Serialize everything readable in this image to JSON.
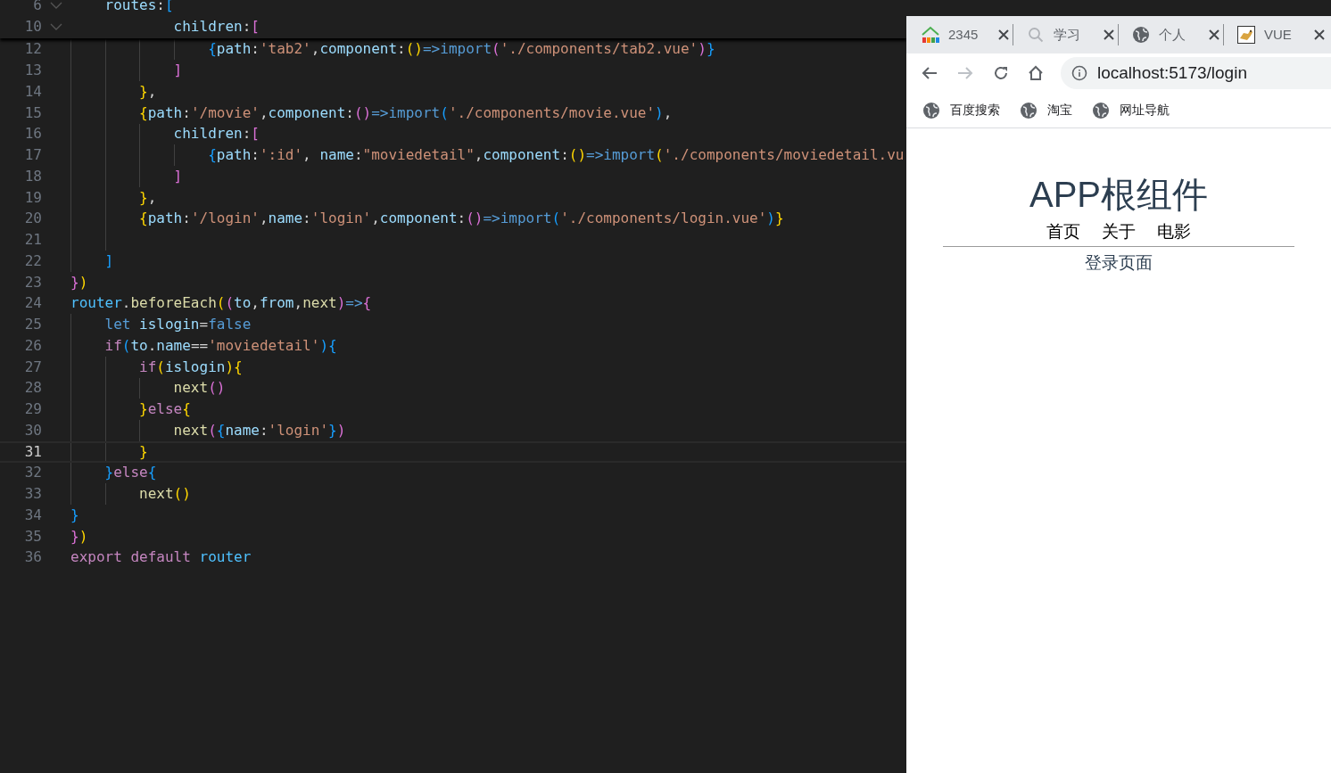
{
  "editor": {
    "sticky_lines": [
      {
        "number": "6",
        "tokens": [
          {
            "t": "    routes",
            "color": "#9cdcfe"
          },
          {
            "t": ":"
          },
          {
            "t": "[",
            "color": "#179fff"
          }
        ]
      },
      {
        "number": "10",
        "tokens": [
          {
            "t": "            children",
            "color": "#9cdcfe"
          },
          {
            "t": ":"
          },
          {
            "t": "[",
            "color": "#da70d6"
          }
        ]
      }
    ],
    "lines": [
      {
        "number": "12",
        "current": false,
        "tokens": [
          {
            "t": "                {",
            "color": "#179fff"
          },
          {
            "t": "path",
            "color": "#9cdcfe"
          },
          {
            "t": ":"
          },
          {
            "t": "'tab2'",
            "color": "#ce9178"
          },
          {
            "t": ","
          },
          {
            "t": "component",
            "color": "#9cdcfe"
          },
          {
            "t": ":"
          },
          {
            "t": "()",
            "color": "#ffd700"
          },
          {
            "t": "=>",
            "color": "#569cd6"
          },
          {
            "t": "import",
            "color": "#569cd6"
          },
          {
            "t": "(",
            "color": "#da70d6"
          },
          {
            "t": "'./components/tab2.vue'",
            "color": "#ce9178"
          },
          {
            "t": ")",
            "color": "#da70d6"
          },
          {
            "t": "}",
            "color": "#179fff"
          }
        ]
      },
      {
        "number": "13",
        "current": false,
        "tokens": [
          {
            "t": "            ]",
            "color": "#da70d6"
          }
        ]
      },
      {
        "number": "14",
        "current": false,
        "tokens": [
          {
            "t": "        }",
            "color": "#ffd700"
          },
          {
            "t": ","
          }
        ]
      },
      {
        "number": "15",
        "current": false,
        "tokens": [
          {
            "t": "        {",
            "color": "#ffd700"
          },
          {
            "t": "path",
            "color": "#9cdcfe"
          },
          {
            "t": ":"
          },
          {
            "t": "'/movie'",
            "color": "#ce9178"
          },
          {
            "t": ","
          },
          {
            "t": "component",
            "color": "#9cdcfe"
          },
          {
            "t": ":"
          },
          {
            "t": "()",
            "color": "#da70d6"
          },
          {
            "t": "=>",
            "color": "#569cd6"
          },
          {
            "t": "import",
            "color": "#569cd6"
          },
          {
            "t": "(",
            "color": "#179fff"
          },
          {
            "t": "'./components/movie.vue'",
            "color": "#ce9178"
          },
          {
            "t": ")",
            "color": "#179fff"
          },
          {
            "t": ","
          }
        ]
      },
      {
        "number": "16",
        "current": false,
        "tokens": [
          {
            "t": "            children",
            "color": "#9cdcfe"
          },
          {
            "t": ":"
          },
          {
            "t": "[",
            "color": "#da70d6"
          }
        ]
      },
      {
        "number": "17",
        "current": false,
        "tokens": [
          {
            "t": "                {",
            "color": "#179fff"
          },
          {
            "t": "path",
            "color": "#9cdcfe"
          },
          {
            "t": ":"
          },
          {
            "t": "':id'",
            "color": "#ce9178"
          },
          {
            "t": ", "
          },
          {
            "t": "name",
            "color": "#9cdcfe"
          },
          {
            "t": ":"
          },
          {
            "t": "\"moviedetail\"",
            "color": "#ce9178"
          },
          {
            "t": ","
          },
          {
            "t": "component",
            "color": "#9cdcfe"
          },
          {
            "t": ":"
          },
          {
            "t": "()",
            "color": "#ffd700"
          },
          {
            "t": "=>",
            "color": "#569cd6"
          },
          {
            "t": "import",
            "color": "#569cd6"
          },
          {
            "t": "(",
            "color": "#ffd700"
          },
          {
            "t": "'./components/moviedetail.vu",
            "color": "#ce9178"
          }
        ]
      },
      {
        "number": "18",
        "current": false,
        "tokens": [
          {
            "t": "            ]",
            "color": "#da70d6"
          }
        ]
      },
      {
        "number": "19",
        "current": false,
        "tokens": [
          {
            "t": "        }",
            "color": "#ffd700"
          },
          {
            "t": ","
          }
        ]
      },
      {
        "number": "20",
        "current": false,
        "tokens": [
          {
            "t": "        {",
            "color": "#ffd700"
          },
          {
            "t": "path",
            "color": "#9cdcfe"
          },
          {
            "t": ":"
          },
          {
            "t": "'/login'",
            "color": "#ce9178"
          },
          {
            "t": ","
          },
          {
            "t": "name",
            "color": "#9cdcfe"
          },
          {
            "t": ":"
          },
          {
            "t": "'login'",
            "color": "#ce9178"
          },
          {
            "t": ","
          },
          {
            "t": "component",
            "color": "#9cdcfe"
          },
          {
            "t": ":"
          },
          {
            "t": "()",
            "color": "#da70d6"
          },
          {
            "t": "=>",
            "color": "#569cd6"
          },
          {
            "t": "import",
            "color": "#569cd6"
          },
          {
            "t": "(",
            "color": "#179fff"
          },
          {
            "t": "'./components/login.vue'",
            "color": "#ce9178"
          },
          {
            "t": ")",
            "color": "#179fff"
          },
          {
            "t": "}",
            "color": "#ffd700"
          }
        ]
      },
      {
        "number": "21",
        "current": false
      },
      {
        "number": "22",
        "current": false,
        "tokens": [
          {
            "t": "    ]",
            "color": "#179fff"
          }
        ]
      },
      {
        "number": "23",
        "current": false,
        "tokens": [
          {
            "t": "}",
            "color": "#da70d6"
          },
          {
            "t": ")",
            "color": "#ffd700"
          }
        ]
      },
      {
        "number": "24",
        "current": false,
        "tokens": [
          {
            "t": "router",
            "color": "#4fc1ff"
          },
          {
            "t": "."
          },
          {
            "t": "beforeEach",
            "color": "#dcdcaa"
          },
          {
            "t": "(",
            "color": "#ffd700"
          },
          {
            "t": "(",
            "color": "#da70d6"
          },
          {
            "t": "to",
            "color": "#9cdcfe"
          },
          {
            "t": ","
          },
          {
            "t": "from",
            "color": "#9cdcfe"
          },
          {
            "t": ","
          },
          {
            "t": "next",
            "color": "#dcdcaa"
          },
          {
            "t": ")",
            "color": "#da70d6"
          },
          {
            "t": "=>",
            "color": "#569cd6"
          },
          {
            "t": "{",
            "color": "#da70d6"
          }
        ]
      },
      {
        "number": "25",
        "current": false,
        "tokens": [
          {
            "t": "    let ",
            "color": "#569cd6"
          },
          {
            "t": "islogin",
            "color": "#9cdcfe"
          },
          {
            "t": "="
          },
          {
            "t": "false",
            "color": "#569cd6"
          }
        ]
      },
      {
        "number": "26",
        "current": false,
        "tokens": [
          {
            "t": "    if",
            "color": "#c586c0"
          },
          {
            "t": "(",
            "color": "#179fff"
          },
          {
            "t": "to",
            "color": "#9cdcfe"
          },
          {
            "t": "."
          },
          {
            "t": "name",
            "color": "#9cdcfe"
          },
          {
            "t": "=="
          },
          {
            "t": "'moviedetail'",
            "color": "#ce9178"
          },
          {
            "t": ")",
            "color": "#179fff"
          },
          {
            "t": "{",
            "color": "#179fff"
          }
        ]
      },
      {
        "number": "27",
        "current": false,
        "tokens": [
          {
            "t": "        if",
            "color": "#c586c0"
          },
          {
            "t": "(",
            "color": "#ffd700"
          },
          {
            "t": "islogin",
            "color": "#9cdcfe"
          },
          {
            "t": ")",
            "color": "#ffd700"
          },
          {
            "t": "{",
            "color": "#ffd700"
          }
        ]
      },
      {
        "number": "28",
        "current": false,
        "tokens": [
          {
            "t": "            next",
            "color": "#dcdcaa"
          },
          {
            "t": "()",
            "color": "#da70d6"
          }
        ]
      },
      {
        "number": "29",
        "current": false,
        "tokens": [
          {
            "t": "        }",
            "color": "#ffd700"
          },
          {
            "t": "else",
            "color": "#c586c0"
          },
          {
            "t": "{",
            "color": "#ffd700"
          }
        ]
      },
      {
        "number": "30",
        "current": false,
        "tokens": [
          {
            "t": "            next",
            "color": "#dcdcaa"
          },
          {
            "t": "(",
            "color": "#da70d6"
          },
          {
            "t": "{",
            "color": "#179fff"
          },
          {
            "t": "name",
            "color": "#9cdcfe"
          },
          {
            "t": ":"
          },
          {
            "t": "'login'",
            "color": "#ce9178"
          },
          {
            "t": "}",
            "color": "#179fff"
          },
          {
            "t": ")",
            "color": "#da70d6"
          }
        ]
      },
      {
        "number": "31",
        "current": true,
        "tokens": [
          {
            "t": "        }",
            "color": "#ffd700"
          }
        ]
      },
      {
        "number": "32",
        "current": false,
        "tokens": [
          {
            "t": "    }",
            "color": "#179fff"
          },
          {
            "t": "else",
            "color": "#c586c0"
          },
          {
            "t": "{",
            "color": "#179fff"
          }
        ]
      },
      {
        "number": "33",
        "current": false,
        "tokens": [
          {
            "t": "        next",
            "color": "#dcdcaa"
          },
          {
            "t": "()",
            "color": "#ffd700"
          }
        ]
      },
      {
        "number": "34",
        "current": false,
        "tokens": [
          {
            "t": "}",
            "color": "#179fff"
          }
        ]
      },
      {
        "number": "35",
        "current": false,
        "tokens": [
          {
            "t": "}",
            "color": "#da70d6"
          },
          {
            "t": ")",
            "color": "#ffd700"
          }
        ]
      },
      {
        "number": "36",
        "current": false,
        "tokens": [
          {
            "t": "export ",
            "color": "#c586c0"
          },
          {
            "t": "default ",
            "color": "#c586c0"
          },
          {
            "t": "router",
            "color": "#4fc1ff"
          }
        ]
      }
    ]
  },
  "browser": {
    "tabs": [
      {
        "title": "2345",
        "kind": "house"
      },
      {
        "title": "学习",
        "kind": "search"
      },
      {
        "title": "个人",
        "kind": "globe"
      },
      {
        "title": "VUE",
        "kind": "cat"
      }
    ],
    "back_disabled": false,
    "forward_disabled": true,
    "address": "localhost:5173/login",
    "bookmarks": [
      "百度搜索",
      "淘宝",
      "网址导航"
    ],
    "page": {
      "title": "APP根组件",
      "nav": [
        "首页",
        "关于",
        "电影"
      ],
      "content": "登录页面"
    }
  }
}
